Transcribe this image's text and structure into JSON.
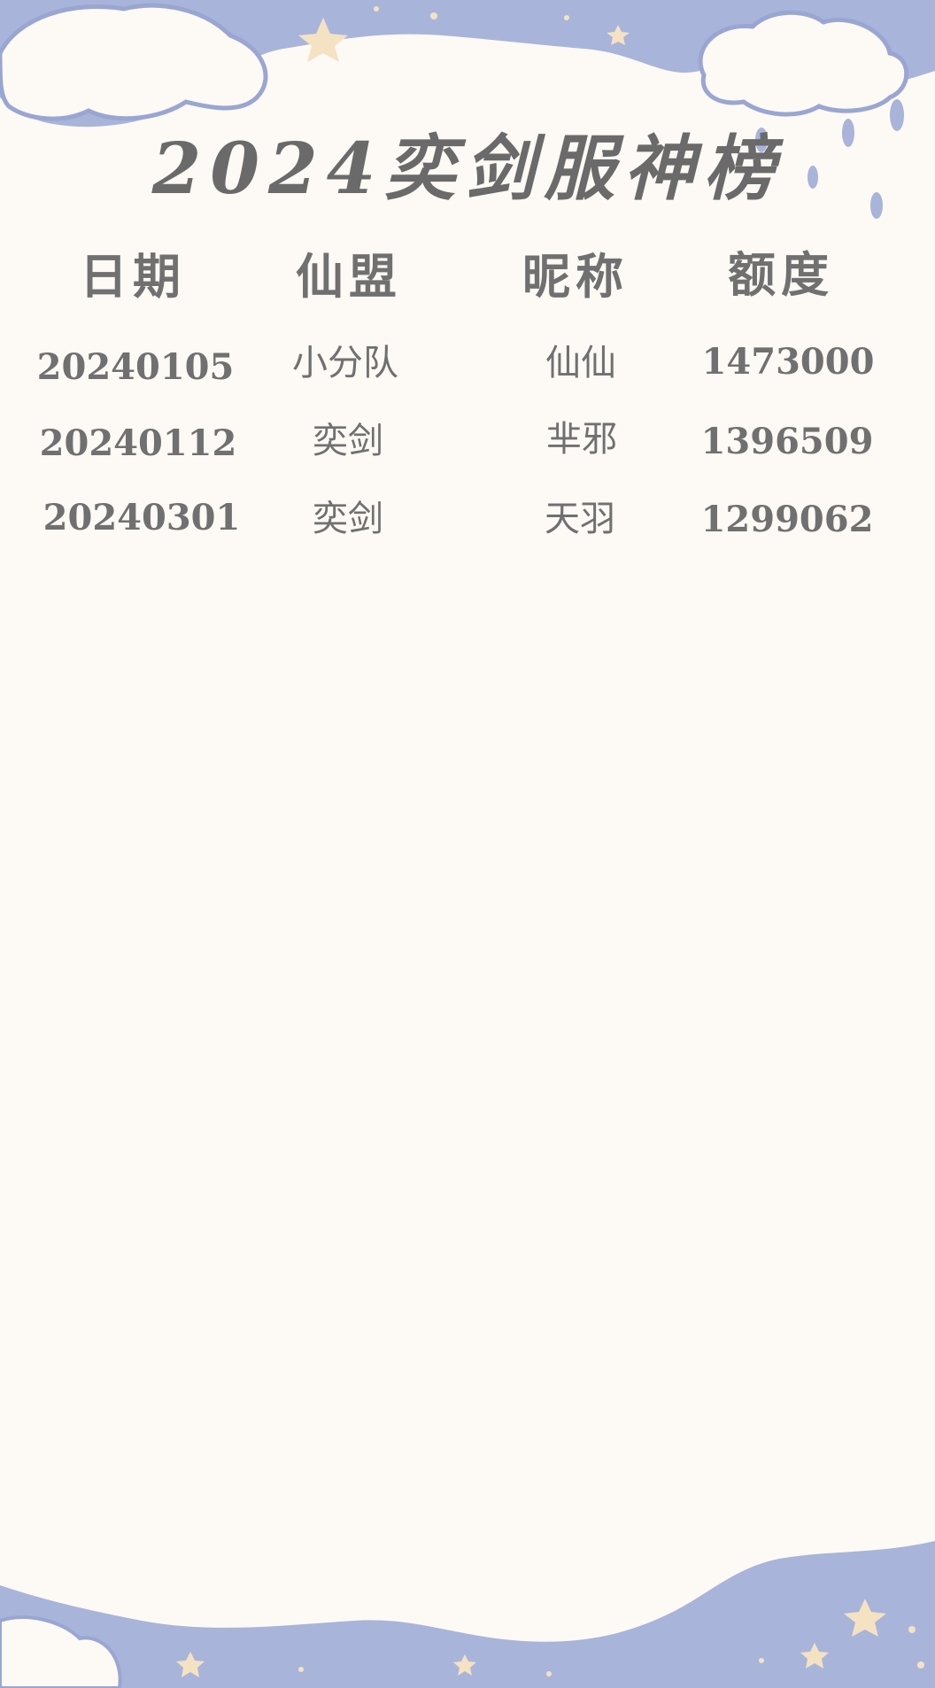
{
  "title": "2024奕剑服神榜",
  "headers": {
    "date": "日期",
    "alliance": "仙盟",
    "nickname": "昵称",
    "amount": "额度"
  },
  "rows": [
    {
      "date": "20240105",
      "alliance": "小分队",
      "nickname": "仙仙",
      "amount": "1473000"
    },
    {
      "date": "20240112",
      "alliance": "奕剑",
      "nickname": "芈邪",
      "amount": "1396509"
    },
    {
      "date": "20240301",
      "alliance": "奕剑",
      "nickname": "天羽",
      "amount": "1299062"
    }
  ],
  "colors": {
    "background": "#fdf9f4",
    "sky": "#a9b4da",
    "cloud_outline": "#9aa6d2",
    "star": "#f4e2c2",
    "text": "#707070"
  }
}
